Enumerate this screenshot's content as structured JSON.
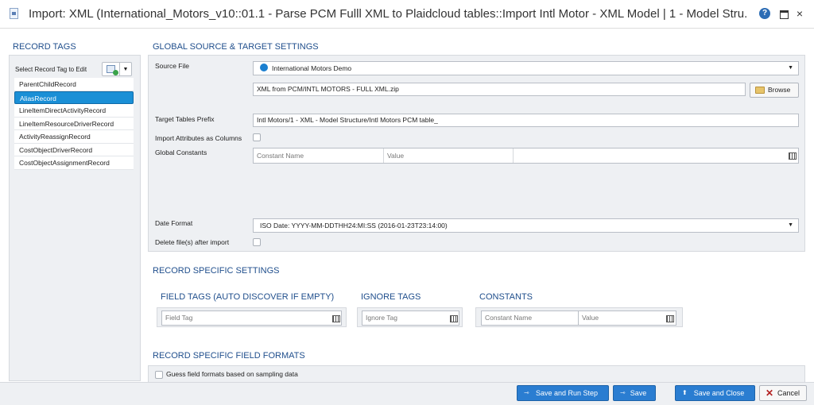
{
  "window": {
    "title": "Import: XML (International_Motors_v10::01.1 - Parse PCM Fulll XML to Plaidcloud tables::Import Intl Motor - XML Model | 1 - Model Stru...",
    "help_icon": "?",
    "maximize_icon": "maximize-icon",
    "close_icon": "×"
  },
  "record_tags": {
    "heading": "RECORD TAGS",
    "select_label": "Select Record Tag to Edit",
    "dropdown_glyph": "▼",
    "items": [
      {
        "label": "ParentChildRecord",
        "selected": false
      },
      {
        "label": "AliasRecord",
        "selected": true
      },
      {
        "label": "LineItemDirectActivityRecord",
        "selected": false
      },
      {
        "label": "LineItemResourceDriverRecord",
        "selected": false
      },
      {
        "label": "ActivityReassignRecord",
        "selected": false
      },
      {
        "label": "CostObjectDriverRecord",
        "selected": false
      },
      {
        "label": "CostObjectAssignmentRecord",
        "selected": false
      }
    ]
  },
  "global_settings": {
    "heading": "GLOBAL SOURCE & TARGET SETTINGS",
    "source_file_label": "Source File",
    "source_file_value": "International Motors Demo",
    "source_path_value": "XML from PCM/INTL MOTORS - FULL XML.zip",
    "browse_label": "Browse",
    "target_prefix_label": "Target Tables Prefix",
    "target_prefix_value": "Intl Motors/1 - XML - Model Structure/Intl Motors PCM table_",
    "import_attributes_label": "Import Attributes as Columns",
    "import_attributes_checked": false,
    "global_constants_label": "Global Constants",
    "constant_name_placeholder": "Constant Name",
    "value_placeholder": "Value",
    "date_format_label": "Date Format",
    "date_format_value": "ISO Date: YYYY-MM-DDTHH24:MI:SS (2016-01-23T23:14:00)",
    "delete_files_label": "Delete file(s) after import",
    "delete_files_checked": false,
    "caret": "▼"
  },
  "record_specific": {
    "heading": "RECORD SPECIFIC SETTINGS",
    "field_tags_heading": "FIELD TAGS (AUTO DISCOVER IF EMPTY)",
    "field_tag_placeholder": "Field Tag",
    "ignore_tags_heading": "IGNORE TAGS",
    "ignore_tag_placeholder": "Ignore Tag",
    "constants_heading": "CONSTANTS",
    "constant_name_placeholder": "Constant Name",
    "value_placeholder": "Value"
  },
  "field_formats": {
    "heading": "RECORD SPECIFIC FIELD FORMATS",
    "guess_label": "Guess field formats based on sampling data",
    "guess_checked": false
  },
  "footer": {
    "save_run_label": "Save and Run Step",
    "save_label": "Save",
    "save_close_label": "Save and Close",
    "cancel_label": "Cancel",
    "save_icon": "⇾",
    "upload_icon": "⬆",
    "cancel_icon": "✕"
  }
}
